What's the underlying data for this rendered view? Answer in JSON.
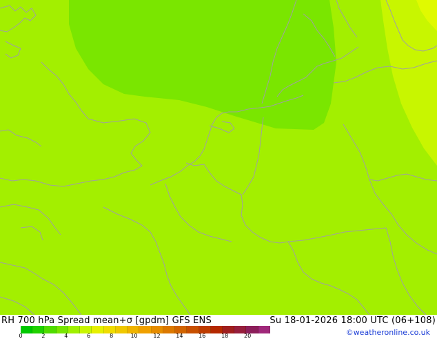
{
  "map": {
    "background_color": "#a3ef00",
    "field_colors": {
      "low_spread": "#7ae600",
      "base": "#a3ef00",
      "higher_spread": "#c8f600",
      "highest_spread": "#e0fa00"
    },
    "coastline_color": "#a0a0a0"
  },
  "footer": {
    "title": "RH 700 hPa Spread mean+σ [gpdm] GFS ENS",
    "datetime": "Su 18-01-2026 18:00 UTC (06+108)",
    "credit": "©weatheronline.co.uk"
  },
  "legend": {
    "colors": [
      "#00c800",
      "#20d200",
      "#50dc00",
      "#78e600",
      "#a0f000",
      "#c8f500",
      "#e6f000",
      "#f0dc00",
      "#f0c800",
      "#f0b400",
      "#f0a000",
      "#e68c00",
      "#dc7800",
      "#d26400",
      "#c85000",
      "#be3c00",
      "#b42800",
      "#a01e1e",
      "#961e3c",
      "#8c1e5a",
      "#a0287a"
    ],
    "labels": [
      {
        "text": "0",
        "value": 0
      },
      {
        "text": "2",
        "value": 2
      },
      {
        "text": "4",
        "value": 4
      },
      {
        "text": "6",
        "value": 6
      },
      {
        "text": "8",
        "value": 8
      },
      {
        "text": "10",
        "value": 10
      },
      {
        "text": "12",
        "value": 12
      },
      {
        "text": "14",
        "value": 14
      },
      {
        "text": "16",
        "value": 16
      },
      {
        "text": "18",
        "value": 18
      },
      {
        "text": "20",
        "value": 20
      }
    ],
    "min": 0,
    "max": 22
  }
}
